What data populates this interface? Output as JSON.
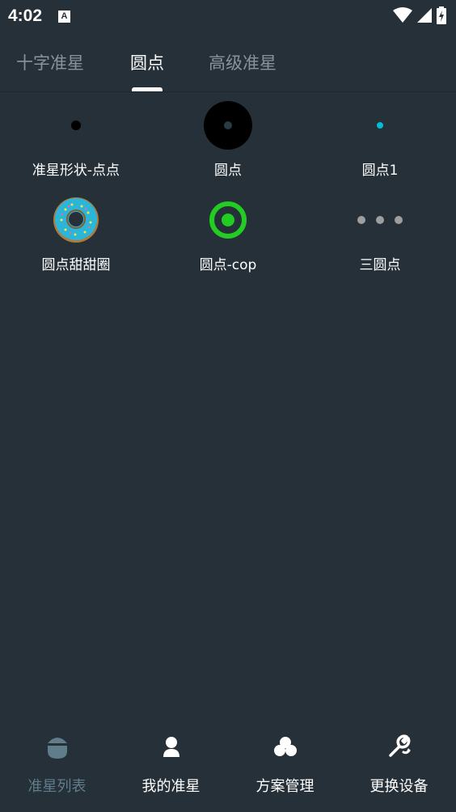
{
  "status_bar": {
    "time": "4:02",
    "notification_glyph": "A",
    "icons": [
      "wifi-icon",
      "signal-icon",
      "battery-charging-icon"
    ]
  },
  "tabs": [
    {
      "label": "十字准星",
      "active": false
    },
    {
      "label": "圆点",
      "active": true
    },
    {
      "label": "高级准星",
      "active": false
    }
  ],
  "crosshairs": [
    {
      "label": "准星形状-点点",
      "icon": "small-black-dot-icon"
    },
    {
      "label": "圆点",
      "icon": "black-circle-dot-icon"
    },
    {
      "label": "圆点1",
      "icon": "teal-dot-icon"
    },
    {
      "label": "圆点甜甜圈",
      "icon": "donut-icon"
    },
    {
      "label": "圆点-cop",
      "icon": "green-ring-dot-icon"
    },
    {
      "label": "三圆点",
      "icon": "three-dots-icon"
    }
  ],
  "bottom_nav": [
    {
      "label": "准星列表",
      "icon": "crosshair-list-icon",
      "active": true
    },
    {
      "label": "我的准星",
      "icon": "user-icon",
      "active": false
    },
    {
      "label": "方案管理",
      "icon": "club-icon",
      "active": false
    },
    {
      "label": "更换设备",
      "icon": "wrench-icon",
      "active": false
    }
  ],
  "colors": {
    "background": "#263038",
    "active_nav": "#607d8b",
    "inactive_tab": "#8a9399",
    "teal_dot": "#00bcd4",
    "green_ring": "#22cc22"
  }
}
